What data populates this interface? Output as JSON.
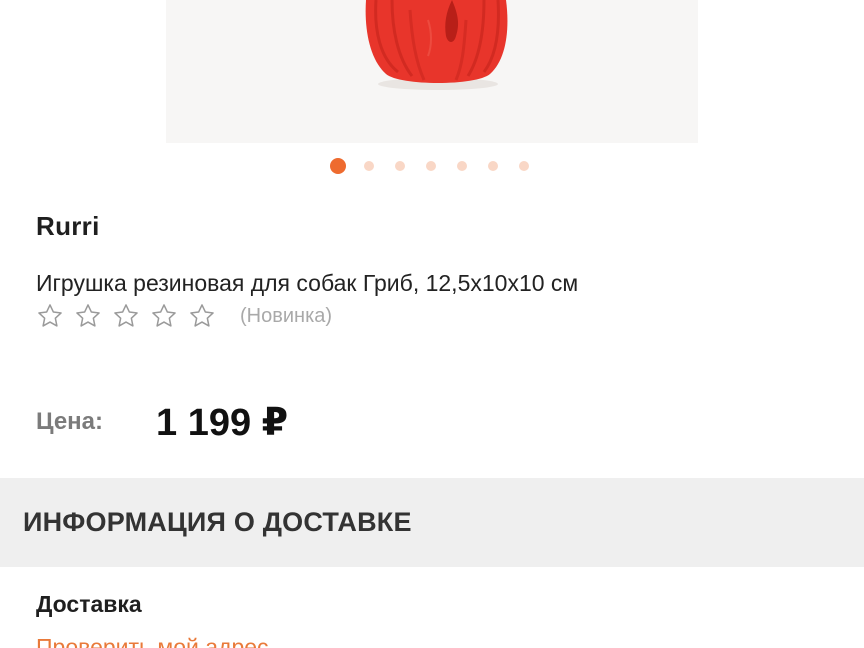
{
  "product": {
    "image_alt": "Игрушка резиновая для собак Гриб",
    "carousel_total": 7,
    "carousel_active": 1,
    "brand": "Rurri",
    "title": "Игрушка резиновая для собак Гриб, 12,5х10х10 см",
    "rating_stars": 0,
    "rating_max": 5,
    "rating_note": "(Новинка)"
  },
  "price": {
    "label": "Цена:",
    "value": "1 199 ₽"
  },
  "delivery": {
    "header": "ИНФОРМАЦИЯ О ДОСТАВКЕ",
    "subtitle": "Доставка",
    "check_link": "Проверить мой адрес"
  },
  "colors": {
    "accent": "#ee6b2f",
    "dot_inactive": "#f9d7c6",
    "product_red": "#e8352b",
    "link": "#e97a3a"
  }
}
